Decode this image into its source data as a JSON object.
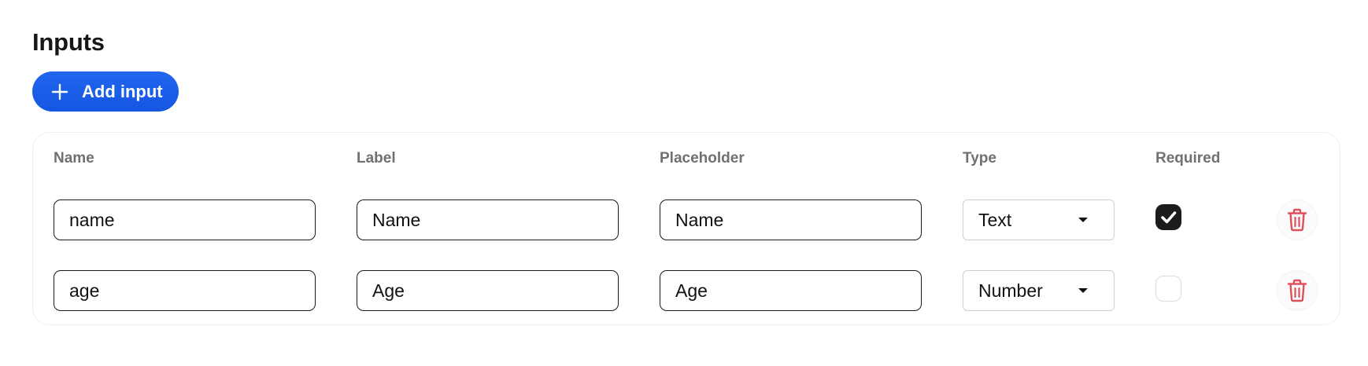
{
  "section": {
    "title": "Inputs"
  },
  "add_button": {
    "label": "Add input",
    "icon": "plus-icon",
    "color": "#1a5ee8"
  },
  "table": {
    "headers": {
      "name": "Name",
      "label": "Label",
      "placeholder": "Placeholder",
      "type": "Type",
      "required": "Required"
    },
    "rows": [
      {
        "name": "name",
        "label": "Name",
        "placeholder": "Name",
        "type": "Text",
        "required": true,
        "delete_icon": "trash-icon"
      },
      {
        "name": "age",
        "label": "Age",
        "placeholder": "Age",
        "type": "Number",
        "required": false,
        "delete_icon": "trash-icon"
      }
    ]
  },
  "colors": {
    "accent": "#1a5ee8",
    "danger": "#e0505a",
    "header_text": "#707070"
  }
}
